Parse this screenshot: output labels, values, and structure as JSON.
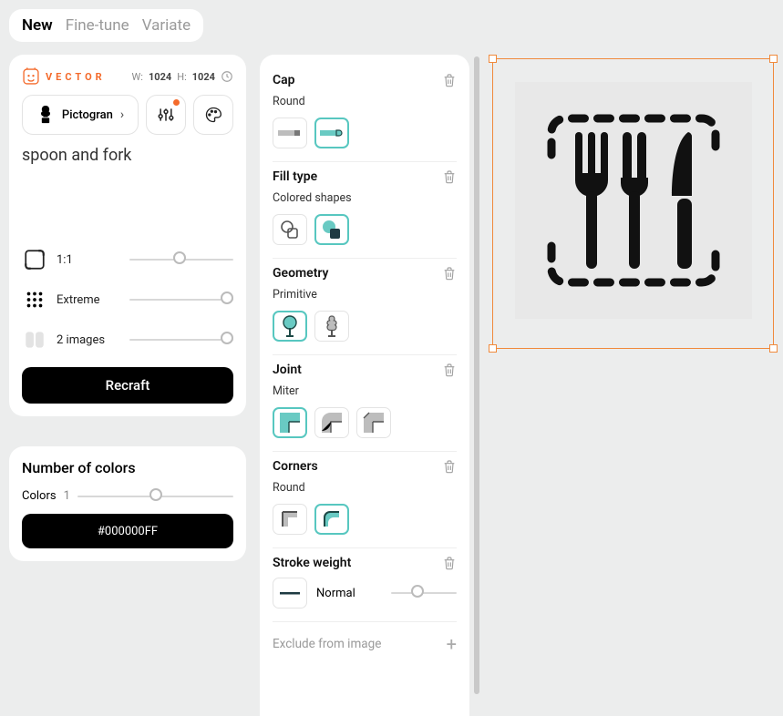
{
  "tabs": {
    "new": "New",
    "finetune": "Fine-tune",
    "variate": "Variate"
  },
  "brand": {
    "label": "VECTOR"
  },
  "dims": {
    "wlabel": "W:",
    "w": "1024",
    "hlabel": "H:",
    "h": "1024"
  },
  "style_chip": {
    "label": "Pictogran"
  },
  "prompt": "spoon and fork",
  "ctrl": {
    "aspect": "1:1",
    "detail": "Extreme",
    "count": "2 images"
  },
  "recraft": "Recraft",
  "colors_panel": {
    "title": "Number of colors",
    "label": "Colors",
    "count": "1",
    "code": "#000000FF"
  },
  "settings": {
    "cap": {
      "title": "Cap",
      "value": "Round"
    },
    "fill": {
      "title": "Fill type",
      "value": "Colored shapes"
    },
    "geometry": {
      "title": "Geometry",
      "value": "Primitive"
    },
    "joint": {
      "title": "Joint",
      "value": "Miter"
    },
    "corners": {
      "title": "Corners",
      "value": "Round"
    },
    "stroke": {
      "title": "Stroke weight",
      "value": "Normal"
    },
    "exclude": "Exclude from image"
  }
}
